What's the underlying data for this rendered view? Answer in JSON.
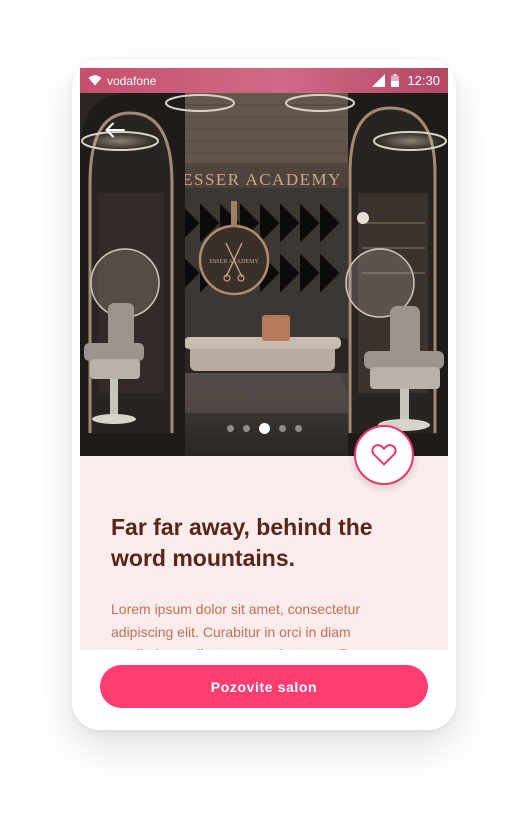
{
  "status_bar": {
    "carrier": "vodafone",
    "time": "12:30",
    "icons": [
      "wifi-icon",
      "signal-icon",
      "battery-icon"
    ]
  },
  "hero": {
    "sign_text": "ESSER ACADEMY",
    "emblem_text": "ESSER ACADEMY",
    "carousel": {
      "total": 5,
      "active_index": 2
    }
  },
  "navigation": {
    "back_icon": "arrow-left-icon"
  },
  "favorite": {
    "icon": "heart-outline-icon",
    "color": "#e8396b"
  },
  "content": {
    "title": "Far far away, behind the word mountains.",
    "description": "Lorem ipsum dolor sit amet, consectetur adipiscing elit. Curabitur in orci in diam vestibulum pellentesque vel ut urna. Fusce"
  },
  "cta": {
    "label": "Pozovite salon",
    "color": "#ff3d71"
  },
  "colors": {
    "status_bar": "#c5506e",
    "content_background": "#fbecec",
    "title": "#5a2418",
    "description": "#c0705a"
  }
}
